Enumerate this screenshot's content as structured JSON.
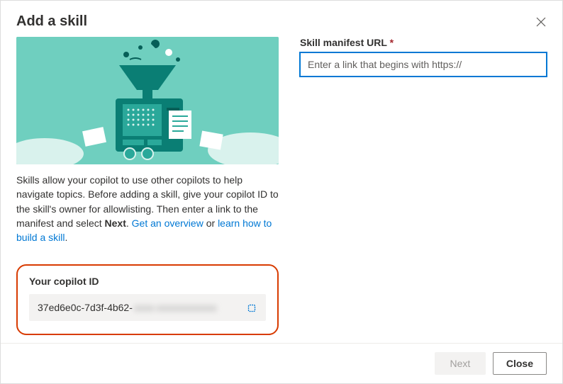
{
  "dialog": {
    "title": "Add a skill",
    "description_part1": "Skills allow your copilot to use other copilots to help navigate topics. Before adding a skill, give your copilot ID to the skill's owner for allowlisting. Then enter a link to the manifest and select ",
    "description_bold": "Next",
    "description_part2": ". ",
    "link_overview": "Get an overview",
    "description_or": " or ",
    "link_learn": "learn how to build a skill",
    "description_end": "."
  },
  "copilot": {
    "label": "Your copilot ID",
    "id_visible": "37ed6e0c-7d3f-4b62-",
    "id_hidden": "xxxx-xxxxxxxxxxxx"
  },
  "form": {
    "manifest_label": "Skill manifest URL",
    "required_mark": "*",
    "manifest_placeholder": "Enter a link that begins with https://"
  },
  "footer": {
    "next": "Next",
    "close": "Close"
  }
}
